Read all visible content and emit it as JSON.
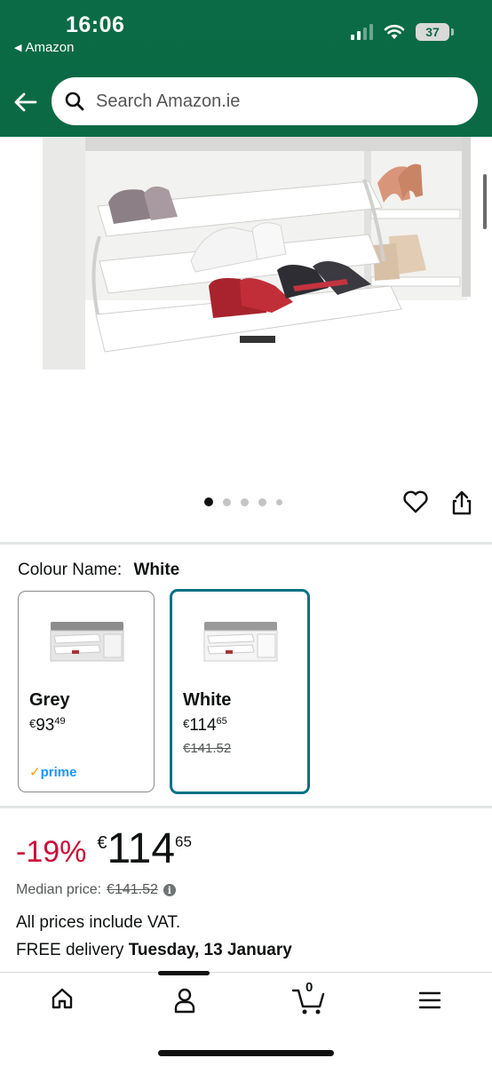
{
  "status_bar": {
    "time": "16:06",
    "back_app": "Amazon",
    "battery": "37"
  },
  "header": {
    "search_placeholder": "Search Amazon.ie",
    "background_color": "#0b6a44"
  },
  "product": {
    "carousel_dot_count": 5,
    "carousel_active_index": 0
  },
  "colour": {
    "label": "Colour Name:",
    "selected": "White",
    "options": [
      {
        "name": "Grey",
        "currency": "€",
        "whole": "93",
        "fraction": "49",
        "was": "",
        "prime": "prime",
        "selected": false
      },
      {
        "name": "White",
        "currency": "€",
        "whole": "114",
        "fraction": "65",
        "was": "€141.52",
        "prime": "",
        "selected": true
      }
    ]
  },
  "pricing": {
    "discount": "-19%",
    "currency": "€",
    "whole": "114",
    "fraction": "65",
    "median_label": "Median price:",
    "median_value": "€141.52",
    "vat_note": "All prices include VAT.",
    "delivery_prefix": "FREE delivery",
    "delivery_date": "Tuesday, 13 January",
    "discount_color": "#cc0c39"
  },
  "bottom_nav": {
    "cart_count": "0",
    "items": [
      "home-icon",
      "account-icon",
      "cart-icon",
      "menu-icon"
    ]
  }
}
